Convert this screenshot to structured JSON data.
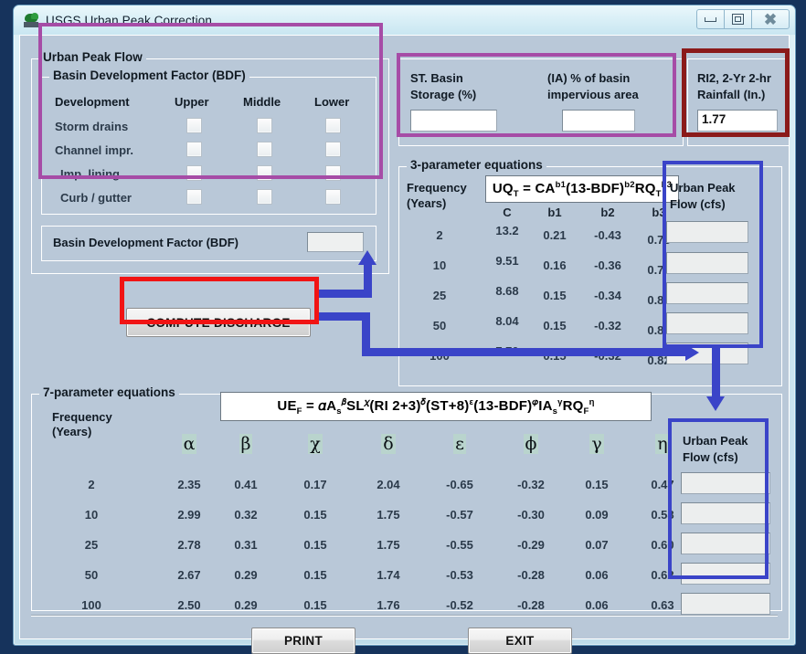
{
  "window": {
    "title": "USGS Urban Peak Correction",
    "icon": "usgs-logo-icon",
    "controls": {
      "minimize": "−",
      "maximize": "□",
      "close": "✖"
    }
  },
  "urban_peak_flow": {
    "legend": "Urban Peak Flow",
    "bdf_group_legend": "Basin Development Factor (BDF)",
    "columns": [
      "Development",
      "Upper",
      "Middle",
      "Lower"
    ],
    "rows": [
      {
        "label": "Storm drains",
        "upper": false,
        "middle": false,
        "lower": false
      },
      {
        "label": "Channel impr.",
        "upper": false,
        "middle": false,
        "lower": false
      },
      {
        "label": "Imp. lining",
        "upper": false,
        "middle": false,
        "lower": false
      },
      {
        "label": "Curb / gutter",
        "upper": false,
        "middle": false,
        "lower": false
      }
    ],
    "bdf_result_label": "Basin Development Factor (BDF)",
    "bdf_result_value": ""
  },
  "inputs": {
    "storage_label_line1": "ST. Basin",
    "storage_label_line2": "Storage (%)",
    "storage_value": "",
    "impervious_label_line1": "(IA) % of basin",
    "impervious_label_line2": "impervious area",
    "impervious_value": "",
    "rainfall_label_line1": "RI2, 2-Yr 2-hr",
    "rainfall_label_line2": "Rainfall (In.)",
    "rainfall_value": "1.77"
  },
  "compute_button": "COMPUTE DISCHARGE",
  "three_param": {
    "legend": "3-parameter equations",
    "formula_plain": "UQT = CA^b1 (13-BDF)^b2 RQT^b3",
    "freq_header_line1": "Frequency",
    "freq_header_line2": "(Years)",
    "result_header_line1": "Urban  Peak",
    "result_header_line2": "Flow (cfs)",
    "columns": [
      "C",
      "b1",
      "b2",
      "b3"
    ],
    "frequencies": [
      "2",
      "10",
      "25",
      "50",
      "100"
    ],
    "rows": [
      {
        "freq": "2",
        "C": "13.2",
        "b1": "0.21",
        "b2": "-0.43",
        "b3": "0.73",
        "result": ""
      },
      {
        "freq": "10",
        "C": "9.51",
        "b1": "0.16",
        "b2": "-0.36",
        "b3": "0.79",
        "result": ""
      },
      {
        "freq": "25",
        "C": "8.68",
        "b1": "0.15",
        "b2": "-0.34",
        "b3": "0.80",
        "result": ""
      },
      {
        "freq": "50",
        "C": "8.04",
        "b1": "0.15",
        "b2": "-0.32",
        "b3": "0.81",
        "result": ""
      },
      {
        "freq": "100",
        "C": "7.70",
        "b1": "0.15",
        "b2": "-0.32",
        "b3": "0.82",
        "result": ""
      }
    ]
  },
  "seven_param": {
    "legend": "7-parameter equations",
    "formula_plain": "UEF = α As^β SL^χ (RI 2+3)^δ (ST+8)^ε (13-BDF)^φ IAs^γ RQF^η",
    "freq_header_line1": "Frequency",
    "freq_header_line2": "(Years)",
    "result_header_line1": "Urban  Peak",
    "result_header_line2": "Flow (cfs)",
    "columns": [
      "α",
      "β",
      "χ",
      "δ",
      "ε",
      "ϕ",
      "γ",
      "η"
    ],
    "rows": [
      {
        "freq": "2",
        "alpha": "2.35",
        "beta": "0.41",
        "chi": "0.17",
        "delta": "2.04",
        "epsilon": "-0.65",
        "phi": "-0.32",
        "gamma": "0.15",
        "eta": "0.47",
        "result": ""
      },
      {
        "freq": "10",
        "alpha": "2.99",
        "beta": "0.32",
        "chi": "0.15",
        "delta": "1.75",
        "epsilon": "-0.57",
        "phi": "-0.30",
        "gamma": "0.09",
        "eta": "0.58",
        "result": ""
      },
      {
        "freq": "25",
        "alpha": "2.78",
        "beta": "0.31",
        "chi": "0.15",
        "delta": "1.75",
        "epsilon": "-0.55",
        "phi": "-0.29",
        "gamma": "0.07",
        "eta": "0.60",
        "result": ""
      },
      {
        "freq": "50",
        "alpha": "2.67",
        "beta": "0.29",
        "chi": "0.15",
        "delta": "1.74",
        "epsilon": "-0.53",
        "phi": "-0.28",
        "gamma": "0.06",
        "eta": "0.62",
        "result": ""
      },
      {
        "freq": "100",
        "alpha": "2.50",
        "beta": "0.29",
        "chi": "0.15",
        "delta": "1.76",
        "epsilon": "-0.52",
        "phi": "-0.28",
        "gamma": "0.06",
        "eta": "0.63",
        "result": ""
      }
    ]
  },
  "footer": {
    "print": "PRINT",
    "exit": "EXIT"
  },
  "annotation_colors": {
    "purple": "#a64ca6",
    "dark_red": "#8b1a1a",
    "red": "#f11414",
    "blue": "#3a44c8"
  }
}
